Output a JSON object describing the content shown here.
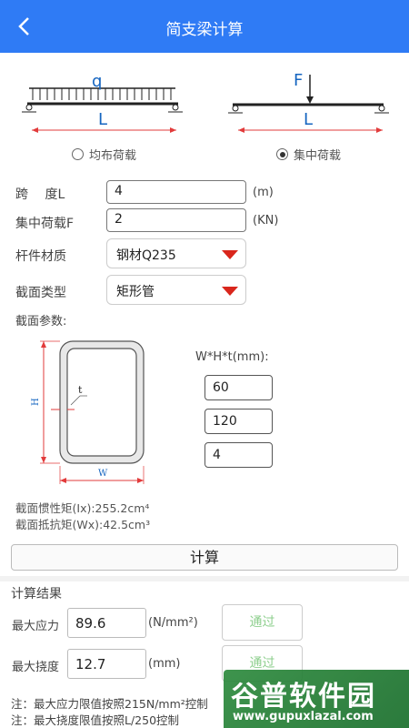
{
  "header": {
    "title": "简支梁计算",
    "back_icon": "chevron-left-icon"
  },
  "beams": {
    "left": {
      "load_symbol": "q",
      "length_symbol": "L",
      "option_label": "均布荷载",
      "selected": false
    },
    "right": {
      "load_symbol": "F",
      "length_symbol": "L",
      "option_label": "集中荷载",
      "selected": true
    }
  },
  "form": {
    "span_label": "跨　 度L",
    "span_value": "4",
    "span_unit": "(m)",
    "load_label": "集中荷载F",
    "load_value": "2",
    "load_unit": "(KN)",
    "material_label": "杆件材质",
    "material_value": "钢材Q235",
    "section_type_label": "截面类型",
    "section_type_value": "矩形管",
    "section_params_label": "截面参数:"
  },
  "section": {
    "dims_label": "W*H*t(mm):",
    "w_value": "60",
    "h_value": "120",
    "t_value": "4",
    "diagram_h": "H",
    "diagram_w": "W",
    "diagram_t": "t"
  },
  "properties": {
    "ix_text": "截面惯性矩(Ix):255.2cm⁴",
    "wx_text": "截面抵抗矩(Wx):42.5cm³"
  },
  "calc_button": "计算",
  "results": {
    "title": "计算结果",
    "stress_label": "最大应力",
    "stress_value": "89.6",
    "stress_unit": "(N/mm²)",
    "stress_status": "通过",
    "deflection_label": "最大挠度",
    "deflection_value": "12.7",
    "deflection_unit": "(mm)",
    "deflection_status": "通过"
  },
  "notes": {
    "note1": "注：最大应力限值按照215N/mm²控制",
    "note2": "注：最大挠度限值按照L/250控制"
  },
  "watermark": {
    "main": "谷普软件园",
    "sub": "www.gupuxlazal.com"
  },
  "colors": {
    "header": "#2f7bf5",
    "dim_red": "#d9261c",
    "pass_green": "#8ecf8e"
  }
}
